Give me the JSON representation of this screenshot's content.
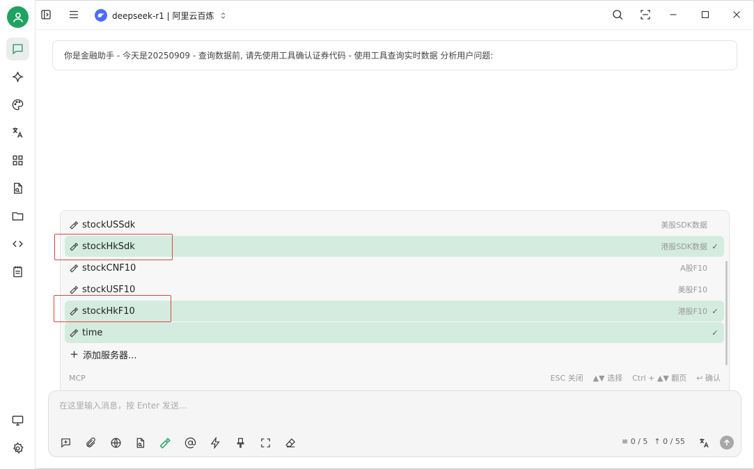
{
  "header": {
    "model_name": "deepseek-r1 | 阿里云百炼"
  },
  "system_prompt": "你是金融助手 - 今天是20250909 - 查询数据前, 请先使用工具确认证券代码 - 使用工具查询实时数据 分析用户问题:",
  "tools": [
    {
      "name": "stockUSSdk",
      "desc": "美股SDK数据",
      "selected": false
    },
    {
      "name": "stockHkSdk",
      "desc": "港股SDK数据",
      "selected": true
    },
    {
      "name": "stockCNF10",
      "desc": "A股F10",
      "selected": false
    },
    {
      "name": "stockUSF10",
      "desc": "美股F10",
      "selected": false
    },
    {
      "name": "stockHkF10",
      "desc": "港股F10",
      "selected": true
    },
    {
      "name": "time",
      "desc": "",
      "selected": true
    }
  ],
  "add_server_label": "添加服务器...",
  "popup_footer": {
    "section": "MCP",
    "esc_hint": "ESC 关闭",
    "select_hint": "▲▼ 选择",
    "page_hint": "Ctrl + ▲▼ 翻页",
    "confirm_hint": "↩ 确认"
  },
  "check_mark": "✓",
  "input": {
    "placeholder": "在这里输入消息，按 Enter 发送...",
    "value": ""
  },
  "counts": {
    "context": "≡ 0 / 5",
    "tokens": "↑ 0 / 55"
  },
  "colors": {
    "accent": "#1fa360",
    "selected_row": "#d4ecdf",
    "highlight_box": "#e0423a"
  }
}
